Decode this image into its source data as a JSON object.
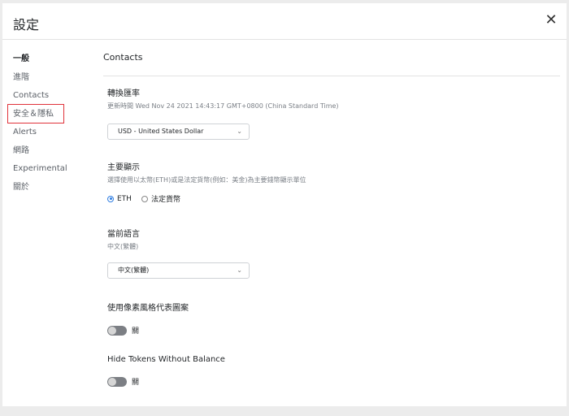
{
  "header": {
    "title": "設定",
    "close_label": "✕"
  },
  "sidebar": {
    "items": [
      {
        "label": "一般",
        "active": true
      },
      {
        "label": "進階"
      },
      {
        "label": "Contacts"
      },
      {
        "label": "安全＆隱私",
        "highlighted": true
      },
      {
        "label": "Alerts"
      },
      {
        "label": "網路"
      },
      {
        "label": "Experimental"
      },
      {
        "label": "關於"
      }
    ]
  },
  "main": {
    "title": "Contacts",
    "conversion": {
      "title": "轉換匯率",
      "desc": "更新時間 Wed Nov 24 2021 14:43:17 GMT+0800 (China Standard Time)",
      "selected": "USD - United States Dollar"
    },
    "primary": {
      "title": "主要顯示",
      "desc": "選擇使用以太幣(ETH)或是法定貨幣(例如：美金)為主要錢幣顯示單位",
      "option_eth": "ETH",
      "option_fiat": "法定貨幣",
      "selected": "ETH"
    },
    "language": {
      "title": "當前語言",
      "desc": "中文(繁體)",
      "selected": "中文(繁體)"
    },
    "identicon": {
      "title": "使用像素風格代表圖案",
      "toggle_label": "關",
      "state": "off"
    },
    "hide_tokens": {
      "title": "Hide Tokens Without Balance",
      "toggle_label": "關",
      "state": "off"
    }
  },
  "colors": {
    "highlight_border": "#e0323a",
    "radio_accent": "#2f7de1",
    "toggle_off": "#7c7f84"
  }
}
